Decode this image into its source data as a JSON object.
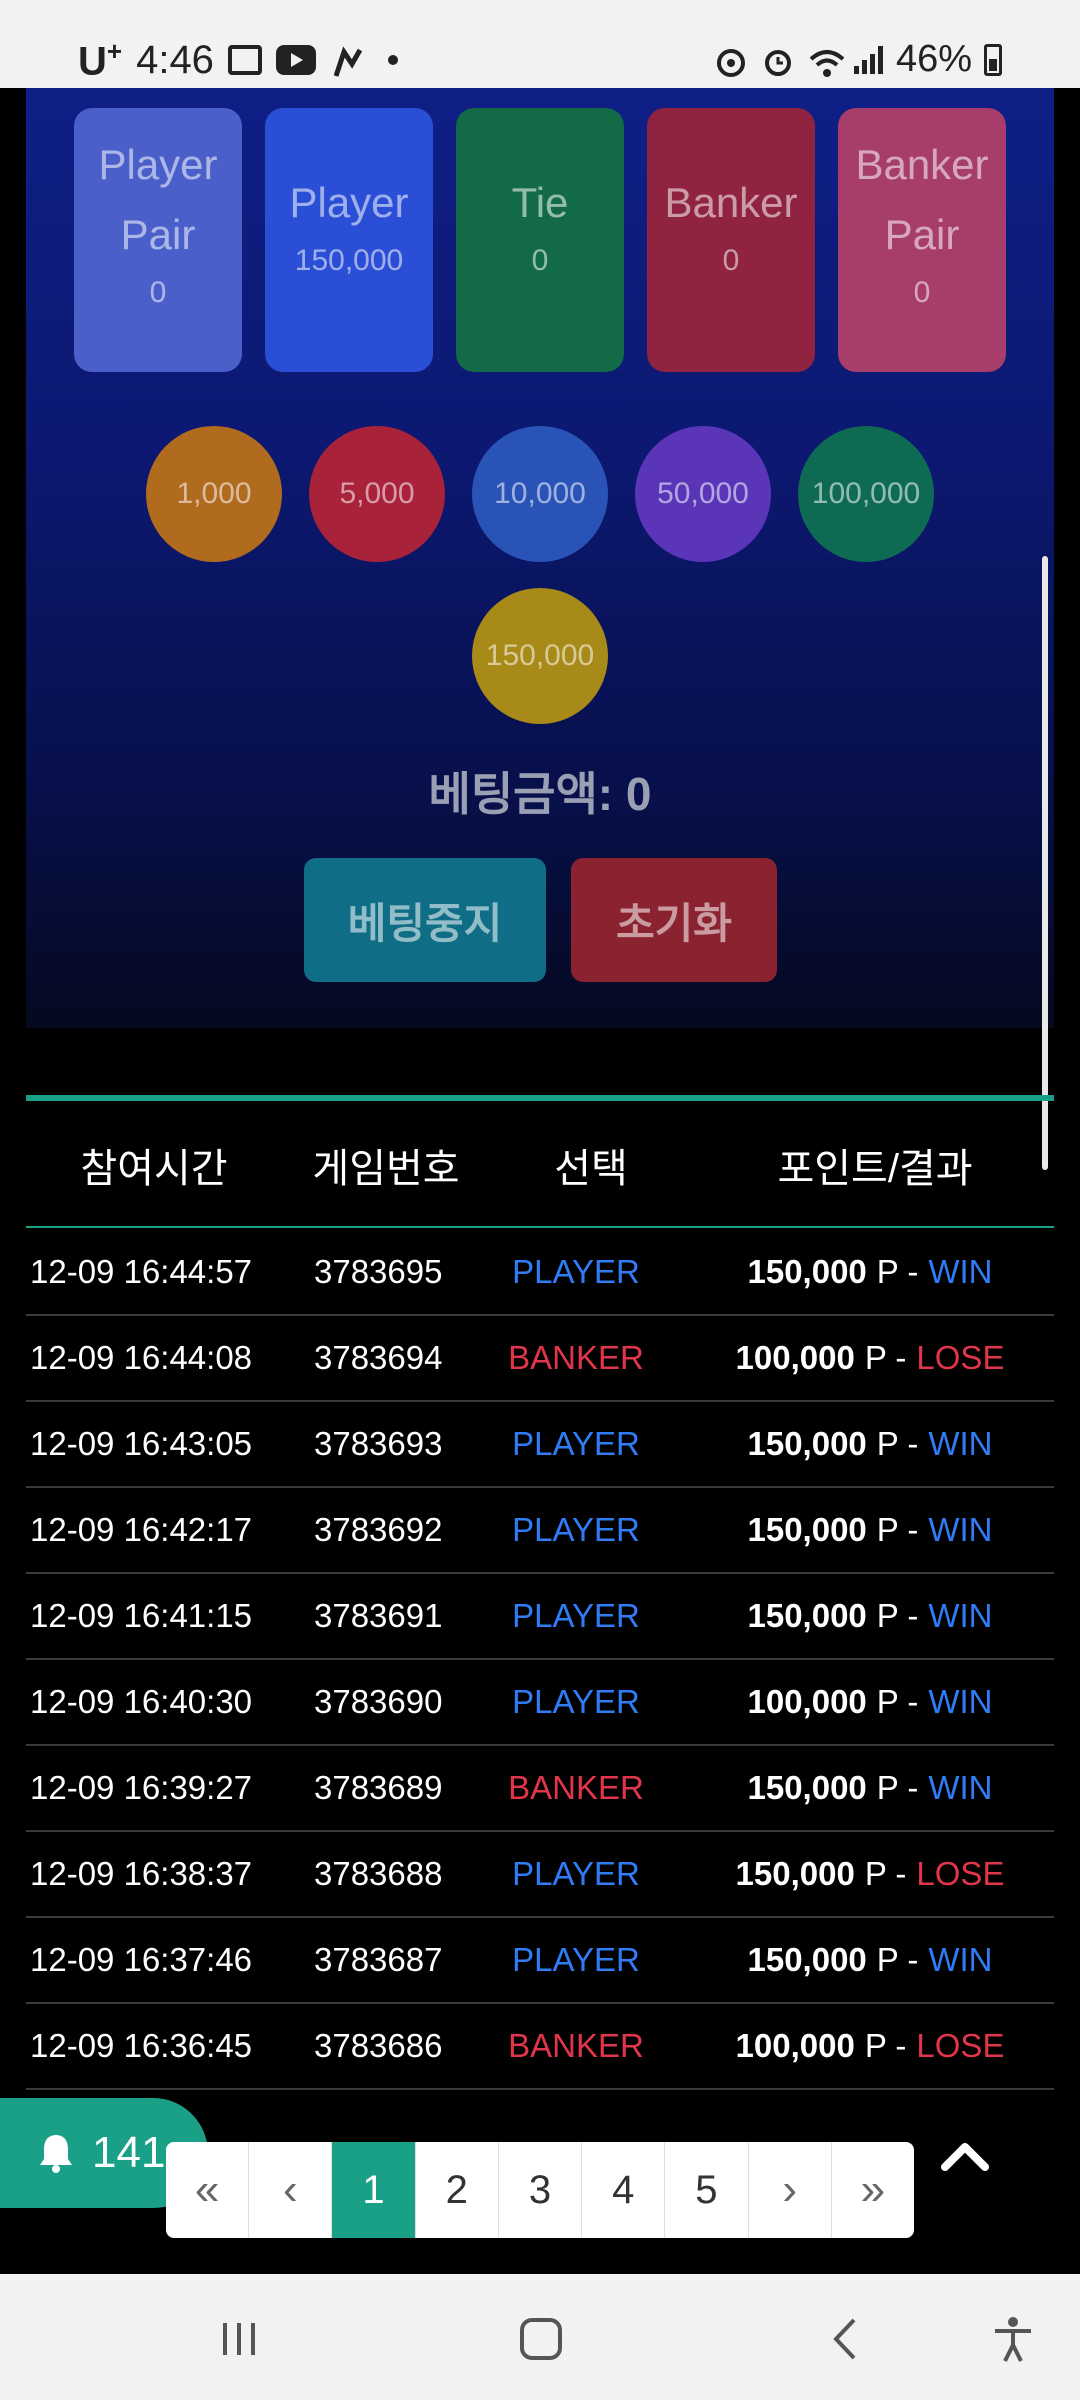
{
  "status_bar": {
    "carrier": "U",
    "carrier_sup": "+",
    "time": "4:46",
    "battery": "46%"
  },
  "bet_boxes": [
    {
      "label1": "Player",
      "label2": "Pair",
      "amount": "0",
      "color": "#4a5fc9"
    },
    {
      "label1": "Player",
      "label2": "",
      "amount": "150,000",
      "color": "#2a4fd6"
    },
    {
      "label1": "Tie",
      "label2": "",
      "amount": "0",
      "color": "#136a47"
    },
    {
      "label1": "Banker",
      "label2": "",
      "amount": "0",
      "color": "#8f2340"
    },
    {
      "label1": "Banker",
      "label2": "Pair",
      "amount": "0",
      "color": "#a63d6a"
    }
  ],
  "chips": [
    {
      "label": "1,000",
      "color": "#b06b1f"
    },
    {
      "label": "5,000",
      "color": "#a8223a"
    },
    {
      "label": "10,000",
      "color": "#2a53b8"
    },
    {
      "label": "50,000",
      "color": "#5a35b8"
    },
    {
      "label": "100,000",
      "color": "#0f6a53"
    },
    {
      "label": "150,000",
      "color": "#a88a18"
    }
  ],
  "bet_total": "베팅금액: 0",
  "buttons": {
    "stop": "베팅중지",
    "reset": "초기화"
  },
  "table": {
    "headers": [
      "참여시간",
      "게임번호",
      "선택",
      "포인트/결과"
    ],
    "rows": [
      {
        "time": "12-09 16:44:57",
        "game": "3783695",
        "choice": "PLAYER",
        "points": "150,000",
        "unit": "P -",
        "result": "WIN"
      },
      {
        "time": "12-09 16:44:08",
        "game": "3783694",
        "choice": "BANKER",
        "points": "100,000",
        "unit": "P -",
        "result": "LOSE"
      },
      {
        "time": "12-09 16:43:05",
        "game": "3783693",
        "choice": "PLAYER",
        "points": "150,000",
        "unit": "P -",
        "result": "WIN"
      },
      {
        "time": "12-09 16:42:17",
        "game": "3783692",
        "choice": "PLAYER",
        "points": "150,000",
        "unit": "P -",
        "result": "WIN"
      },
      {
        "time": "12-09 16:41:15",
        "game": "3783691",
        "choice": "PLAYER",
        "points": "150,000",
        "unit": "P -",
        "result": "WIN"
      },
      {
        "time": "12-09 16:40:30",
        "game": "3783690",
        "choice": "PLAYER",
        "points": "100,000",
        "unit": "P -",
        "result": "WIN"
      },
      {
        "time": "12-09 16:39:27",
        "game": "3783689",
        "choice": "BANKER",
        "points": "150,000",
        "unit": "P -",
        "result": "WIN"
      },
      {
        "time": "12-09 16:38:37",
        "game": "3783688",
        "choice": "PLAYER",
        "points": "150,000",
        "unit": "P -",
        "result": "LOSE"
      },
      {
        "time": "12-09 16:37:46",
        "game": "3783687",
        "choice": "PLAYER",
        "points": "150,000",
        "unit": "P -",
        "result": "WIN"
      },
      {
        "time": "12-09 16:36:45",
        "game": "3783686",
        "choice": "BANKER",
        "points": "100,000",
        "unit": "P -",
        "result": "LOSE"
      }
    ]
  },
  "colors": {
    "player": "#2f7cf6",
    "banker": "#e0354a",
    "win": "#2f7cf6",
    "lose": "#e0354a",
    "accent": "#1aa086"
  },
  "pagination": {
    "first": "«",
    "prev": "‹",
    "pages": [
      "1",
      "2",
      "3",
      "4",
      "5"
    ],
    "active_page": "1",
    "next": "›",
    "last": "»"
  },
  "notification": {
    "icon": "bell-icon",
    "count": "141"
  }
}
